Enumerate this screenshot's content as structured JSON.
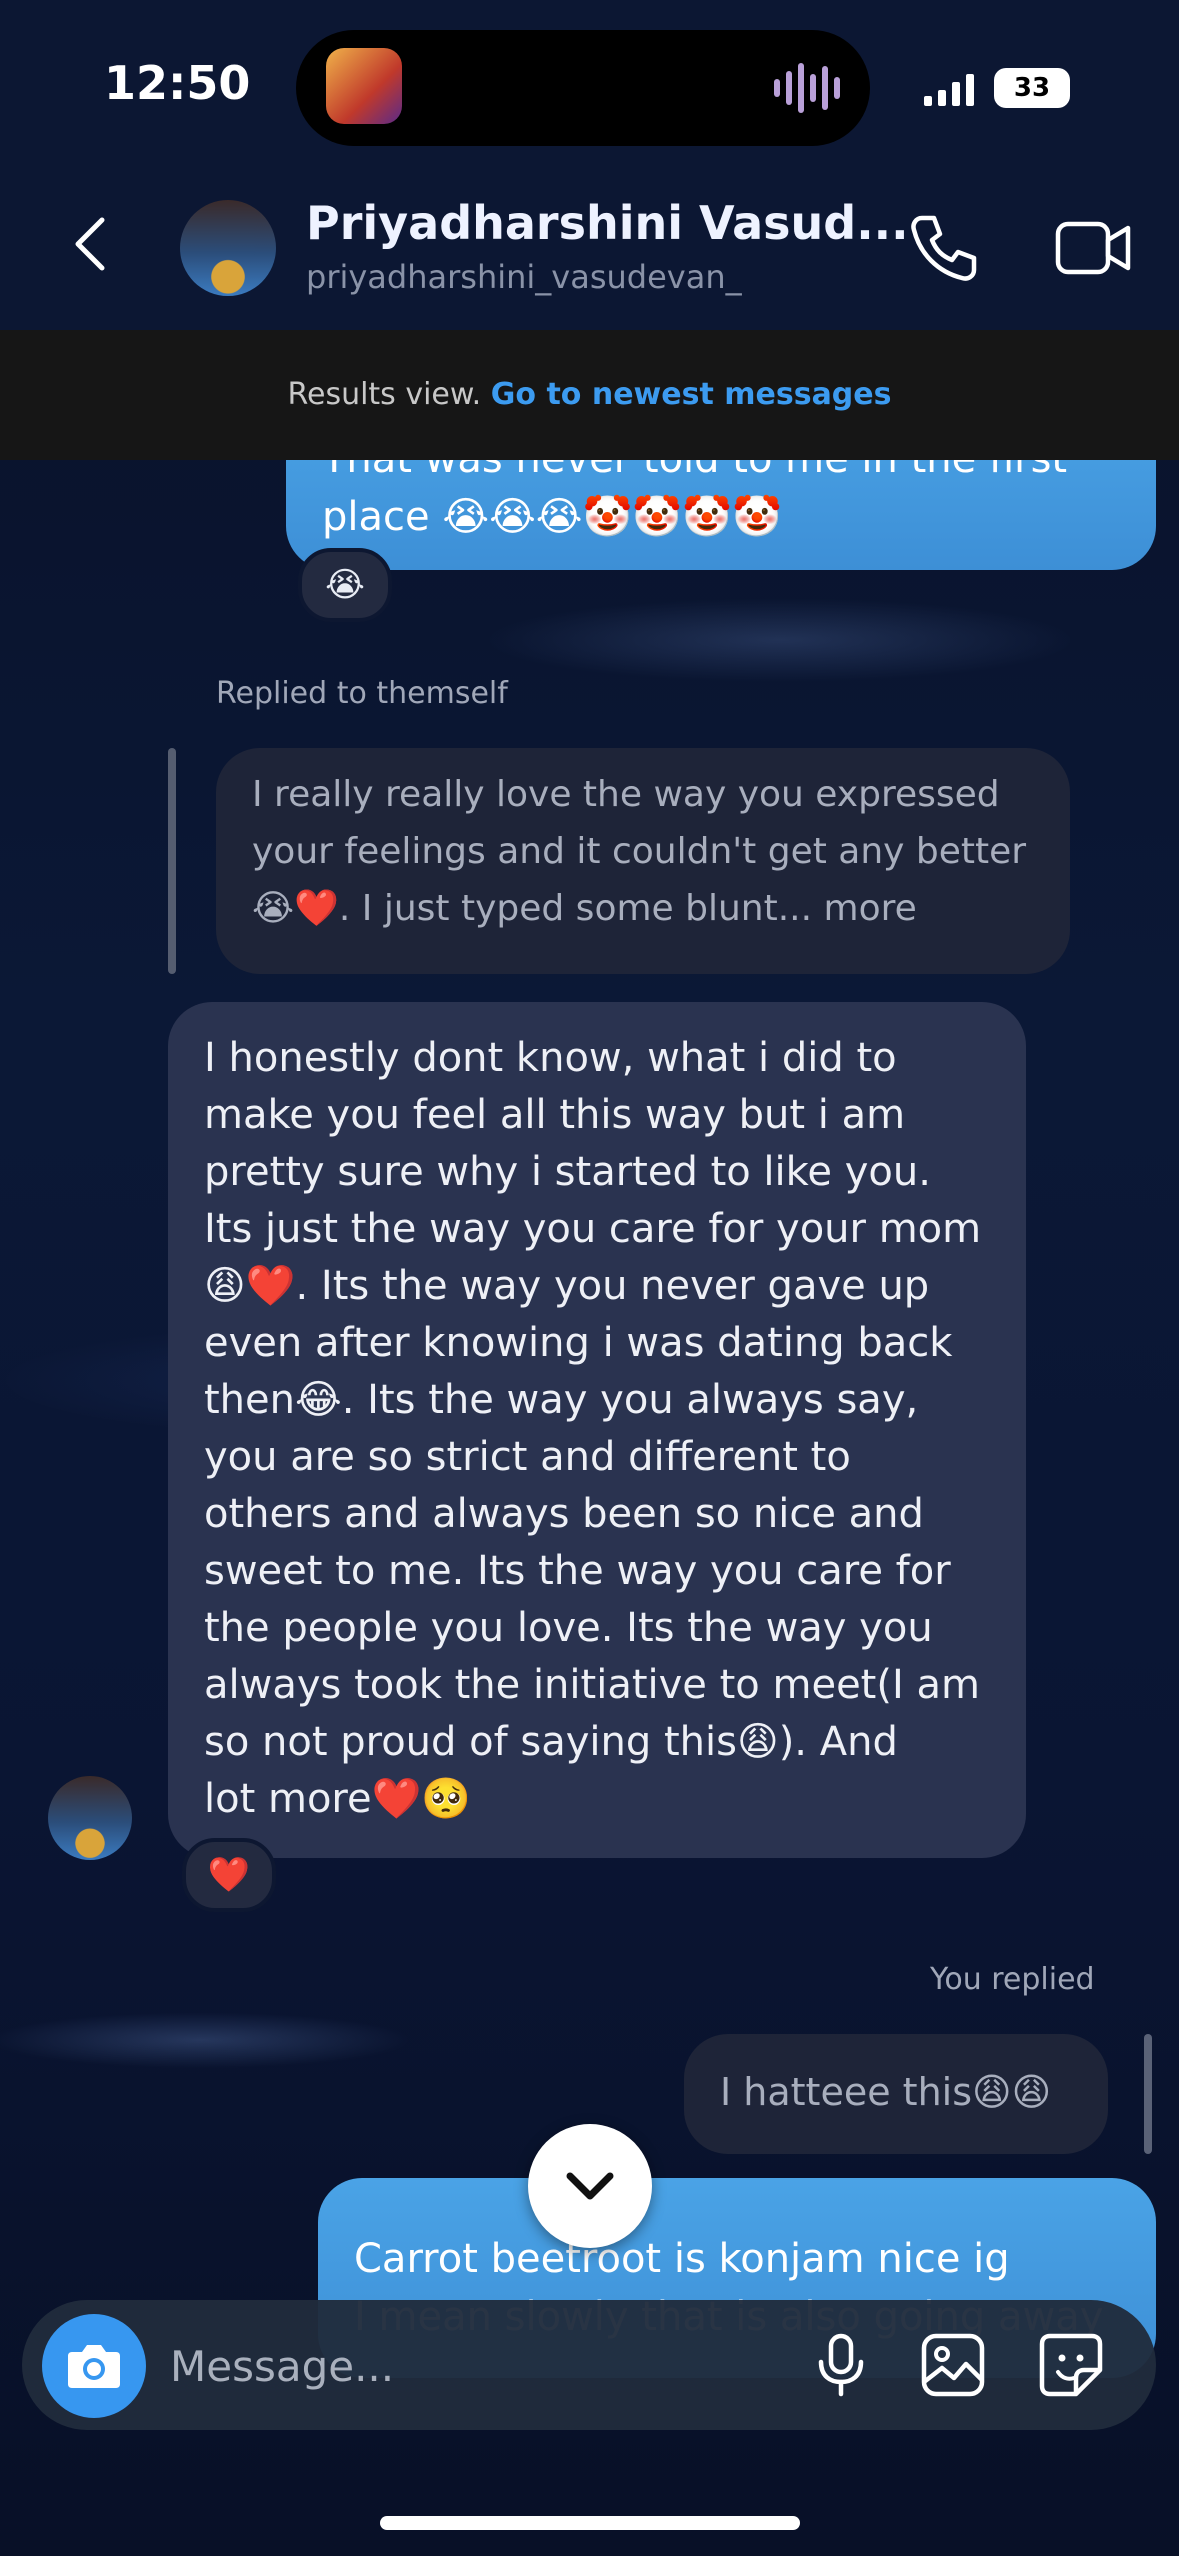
{
  "status_bar": {
    "time": "12:50",
    "battery": "33"
  },
  "header": {
    "name": "Priyadharshini Vasud...",
    "handle": "priyadharshini_vasudevan_"
  },
  "banner": {
    "text": "Results view.",
    "link": "Go to newest messages"
  },
  "messages": {
    "top_sent": {
      "line1": "That was never told to me in the first",
      "line2": "place 😭😭😭🤡🤡🤡🤡",
      "reaction": "😭"
    },
    "replied_label": "Replied to themself",
    "quoted": {
      "line1": "I really really love the way you expressed",
      "line2": "your feelings and it couldn't get any better",
      "line3": "😭❤️. I just typed some blunt... more"
    },
    "received": {
      "lines": [
        "I honestly dont know, what i did to",
        "make you feel all this way but i am",
        "pretty sure why i started to like you.",
        "Its just the way you care for your mom",
        "😩❤️. Its the way you never gave up",
        "even after knowing i was dating back",
        "then😂. Its the way you always say,",
        "you are so strict and different to",
        "others and always been so nice and",
        "sweet to me. Its the way you care for",
        "the people you love. Its the way you",
        "always took the initiative to meet(I am",
        "so not proud of saying this😩). And",
        "lot more❤️🥺"
      ],
      "reaction": "❤️"
    },
    "you_replied_label": "You replied",
    "you_quoted": "I hatteee this😩😩",
    "bottom_sent": {
      "line1": "Carrot beetroot is konjam nice ig",
      "line2": "I mean slowly that is also going away"
    }
  },
  "composer": {
    "placeholder": "Message..."
  },
  "colors": {
    "accent": "#3797f0",
    "sent_bubble": "#4aa3e6",
    "received_bubble": "#2a3350"
  }
}
